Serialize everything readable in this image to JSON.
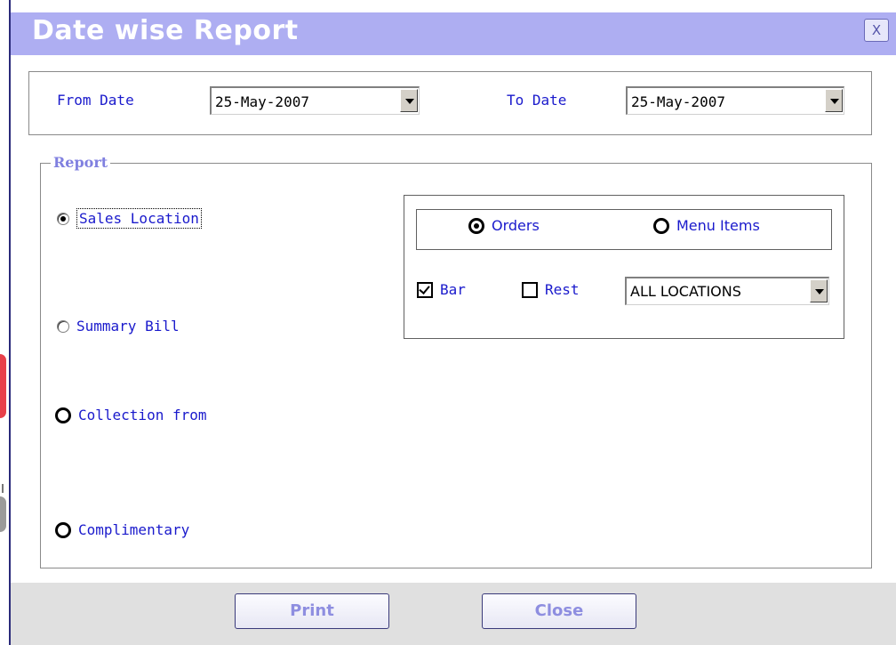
{
  "window": {
    "title": "Date wise Report",
    "close_label": "X"
  },
  "dates": {
    "from_label": "From Date",
    "from_value": "25-May-2007",
    "to_label": "To Date",
    "to_value": "25-May-2007"
  },
  "report": {
    "group_label": "Report",
    "options": [
      {
        "label": "Sales Location",
        "selected": true
      },
      {
        "label": "Summary Bill",
        "selected": false
      },
      {
        "label": "Collection from",
        "selected": false
      },
      {
        "label": "Complimentary",
        "selected": false
      }
    ]
  },
  "filters": {
    "type_options": [
      {
        "label": "Orders",
        "selected": true
      },
      {
        "label": "Menu Items",
        "selected": false
      }
    ],
    "bar": {
      "label": "Bar",
      "checked": true
    },
    "rest": {
      "label": "Rest",
      "checked": false
    },
    "location_value": "ALL LOCATIONS"
  },
  "buttons": {
    "print_label": "Print",
    "close_label": "Close"
  },
  "colors": {
    "title_bar": "#aeaef2",
    "label_text": "#1a1acc",
    "button_text": "#8e8ee0",
    "footer_bg": "#e0e0e0"
  }
}
